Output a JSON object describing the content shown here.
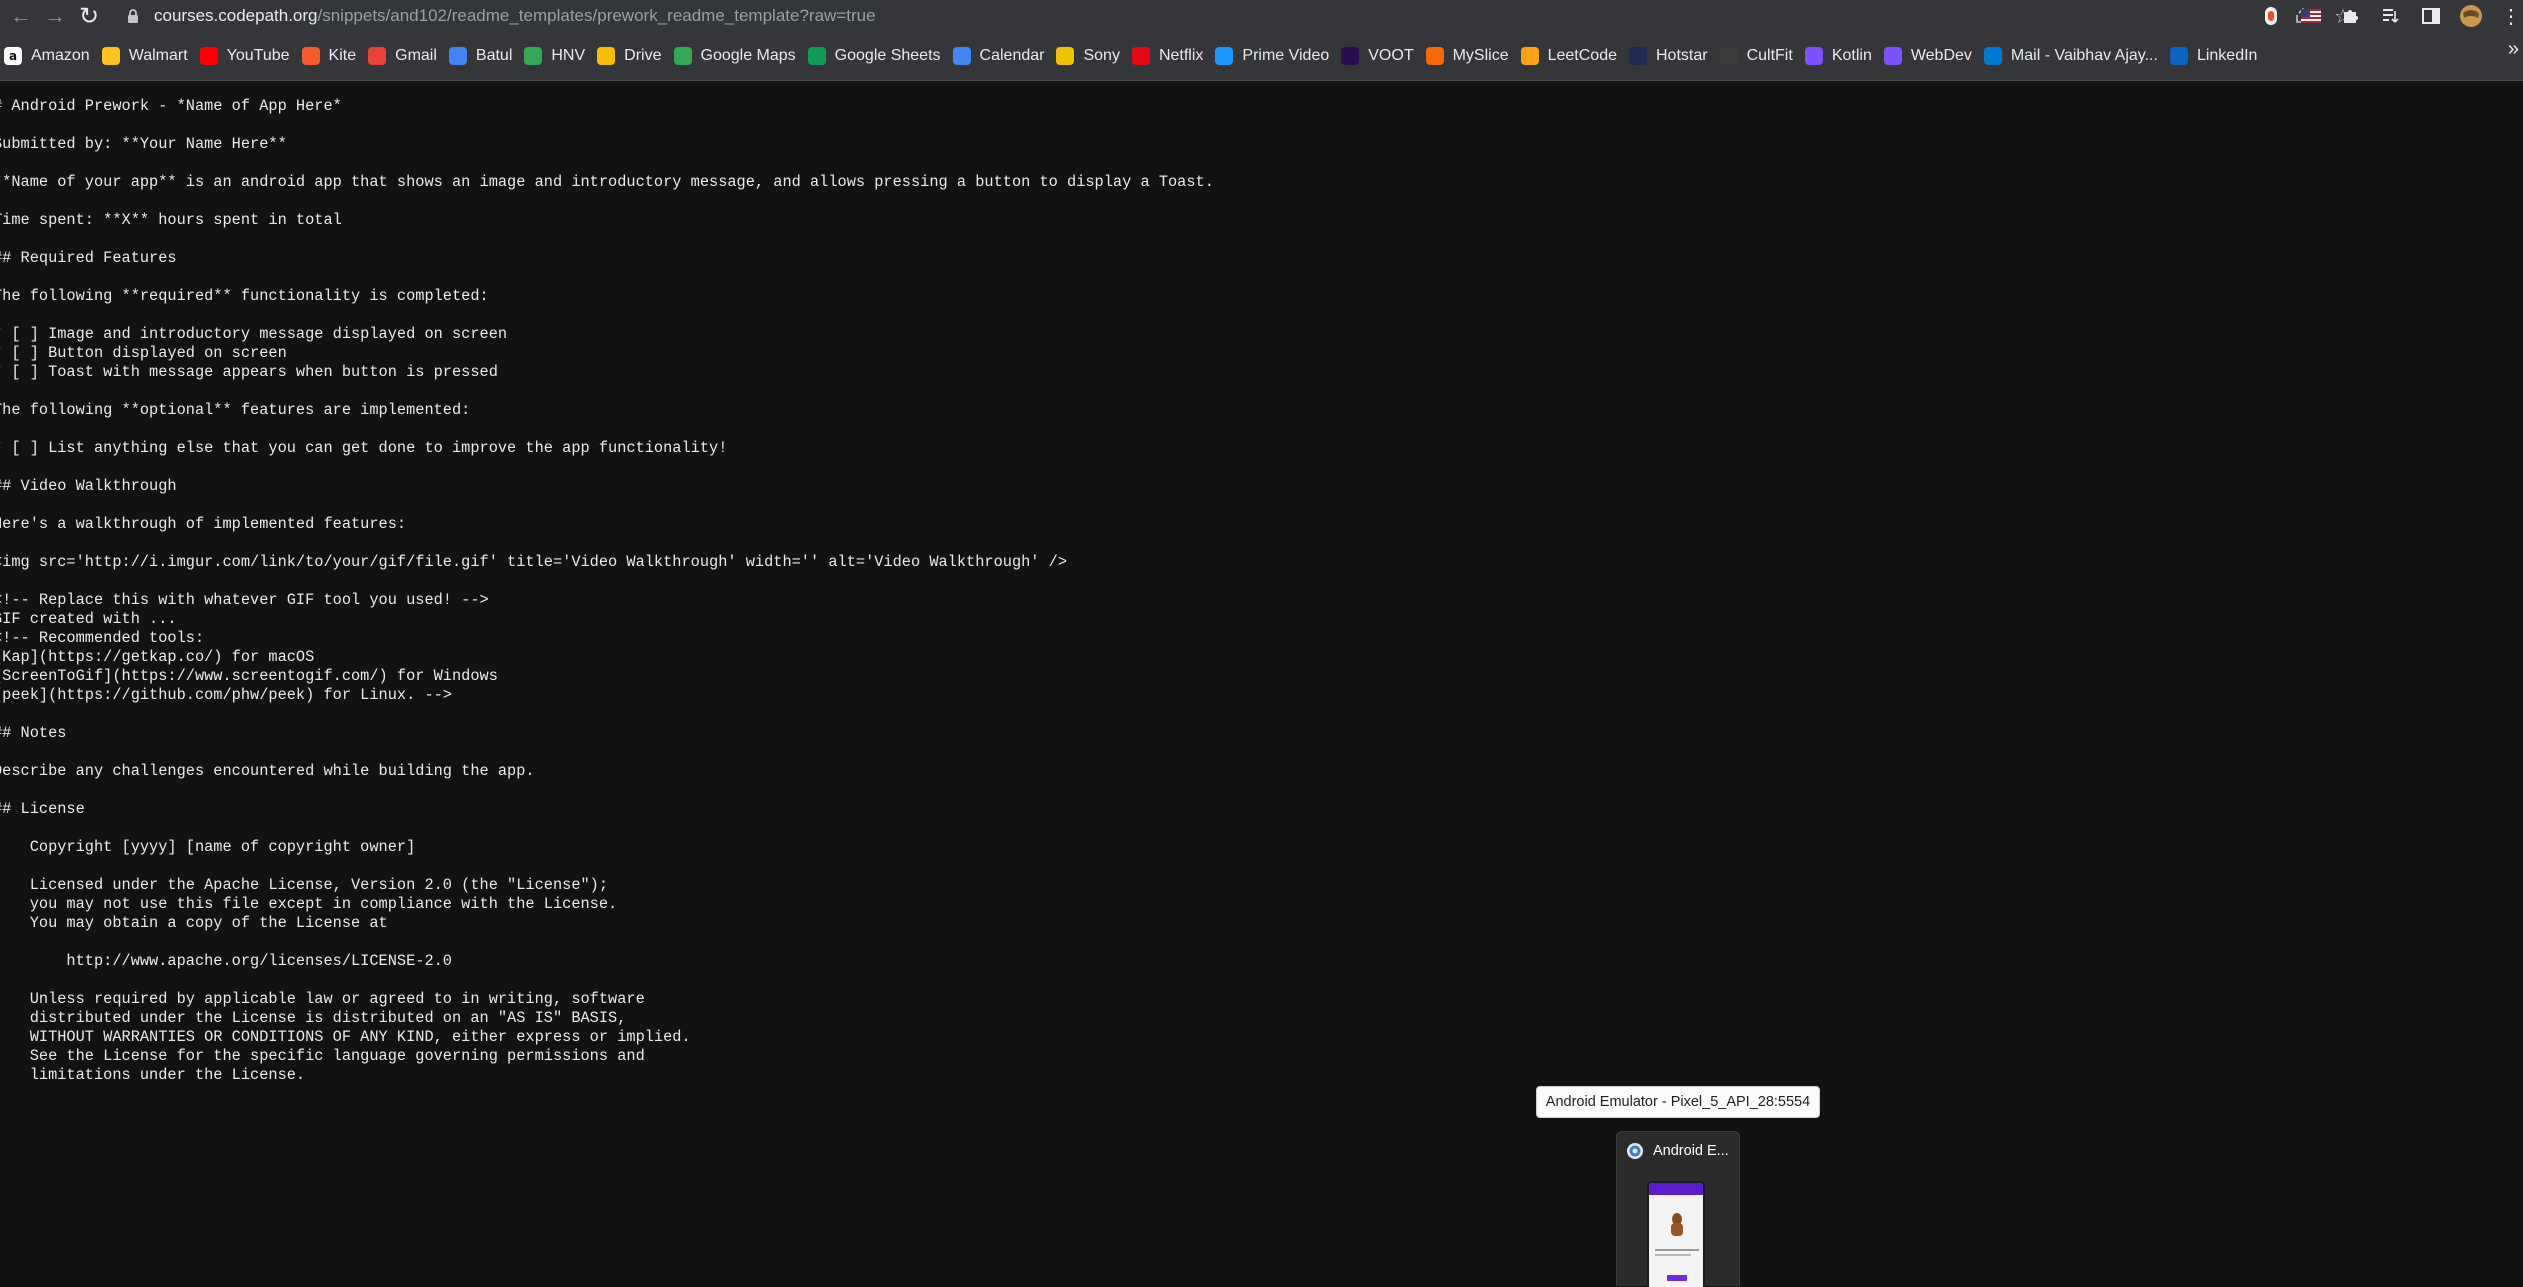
{
  "browser": {
    "url_host": "courses.codepath.org",
    "url_path": "/snippets/and102/readme_templates/prework_readme_template?raw=true",
    "bookmarks": [
      {
        "label": "Amazon",
        "icon": "amazon-icon",
        "color": "#ffffff"
      },
      {
        "label": "Walmart",
        "icon": "walmart-icon",
        "color": "#ffc220"
      },
      {
        "label": "YouTube",
        "icon": "youtube-icon",
        "color": "#ff0000"
      },
      {
        "label": "Kite",
        "icon": "kite-icon",
        "color": "#f35b2b"
      },
      {
        "label": "Gmail",
        "icon": "gmail-icon",
        "color": "#ea4335"
      },
      {
        "label": "Batul",
        "icon": "batul-icon",
        "color": "#4285f4"
      },
      {
        "label": "HNV",
        "icon": "hnv-icon",
        "color": "#34a853"
      },
      {
        "label": "Drive",
        "icon": "drive-icon",
        "color": "#fbbc04"
      },
      {
        "label": "Google Maps",
        "icon": "google-maps-icon",
        "color": "#34a853"
      },
      {
        "label": "Google Sheets",
        "icon": "google-sheets-icon",
        "color": "#0f9d58"
      },
      {
        "label": "Calendar",
        "icon": "calendar-icon",
        "color": "#4285f4"
      },
      {
        "label": "Sony",
        "icon": "sony-icon",
        "color": "#f2c200"
      },
      {
        "label": "Netflix",
        "icon": "netflix-icon",
        "color": "#e50914"
      },
      {
        "label": "Prime Video",
        "icon": "prime-video-icon",
        "color": "#1a98ff"
      },
      {
        "label": "VOOT",
        "icon": "voot-icon",
        "color": "#2a0d4e"
      },
      {
        "label": "MySlice",
        "icon": "myslice-icon",
        "color": "#f76900"
      },
      {
        "label": "LeetCode",
        "icon": "leetcode-icon",
        "color": "#ffa116"
      },
      {
        "label": "Hotstar",
        "icon": "hotstar-icon",
        "color": "#1f2a55"
      },
      {
        "label": "CultFit",
        "icon": "cultfit-icon",
        "color": "#3a3a3a"
      },
      {
        "label": "Kotlin",
        "icon": "kotlin-icon",
        "color": "#7f52ff"
      },
      {
        "label": "WebDev",
        "icon": "webdev-icon",
        "color": "#7f52ff"
      },
      {
        "label": "Mail - Vaibhav Ajay...",
        "icon": "outlook-icon",
        "color": "#0078d4"
      },
      {
        "label": "LinkedIn",
        "icon": "linkedin-icon",
        "color": "#0a66c2"
      }
    ]
  },
  "document": {
    "lines": [
      "# Android Prework - *Name of App Here*",
      "",
      "Submitted by: **Your Name Here**",
      "",
      "**Name of your app** is an android app that shows an image and introductory message, and allows pressing a button to display a Toast.",
      "",
      "Time spent: **X** hours spent in total",
      "",
      "## Required Features",
      "",
      "The following **required** functionality is completed:",
      "",
      "* [ ] Image and introductory message displayed on screen",
      "* [ ] Button displayed on screen",
      "* [ ] Toast with message appears when button is pressed",
      "",
      "The following **optional** features are implemented:",
      "",
      "* [ ] List anything else that you can get done to improve the app functionality!",
      "",
      "## Video Walkthrough",
      "",
      "Here's a walkthrough of implemented features:",
      "",
      "<img src='http://i.imgur.com/link/to/your/gif/file.gif' title='Video Walkthrough' width='' alt='Video Walkthrough' />",
      "",
      "<!-- Replace this with whatever GIF tool you used! -->",
      "GIF created with ...",
      "<!-- Recommended tools:",
      "[Kap](https://getkap.co/) for macOS",
      "[ScreenToGif](https://www.screentogif.com/) for Windows",
      "[peek](https://github.com/phw/peek) for Linux. -->",
      "",
      "## Notes",
      "",
      "Describe any challenges encountered while building the app.",
      "",
      "## License",
      "",
      "    Copyright [yyyy] [name of copyright owner]",
      "",
      "    Licensed under the Apache License, Version 2.0 (the \"License\");",
      "    you may not use this file except in compliance with the License.",
      "    You may obtain a copy of the License at",
      "",
      "        http://www.apache.org/licenses/LICENSE-2.0",
      "",
      "    Unless required by applicable law or agreed to in writing, software",
      "    distributed under the License is distributed on an \"AS IS\" BASIS,",
      "    WITHOUT WARRANTIES OR CONDITIONS OF ANY KIND, either express or implied.",
      "    See the License for the specific language governing permissions and",
      "    limitations under the License."
    ]
  },
  "taskbar_popup": {
    "tooltip": "Android Emulator - Pixel_5_API_28:5554",
    "thumbnail_title": "Android E..."
  }
}
